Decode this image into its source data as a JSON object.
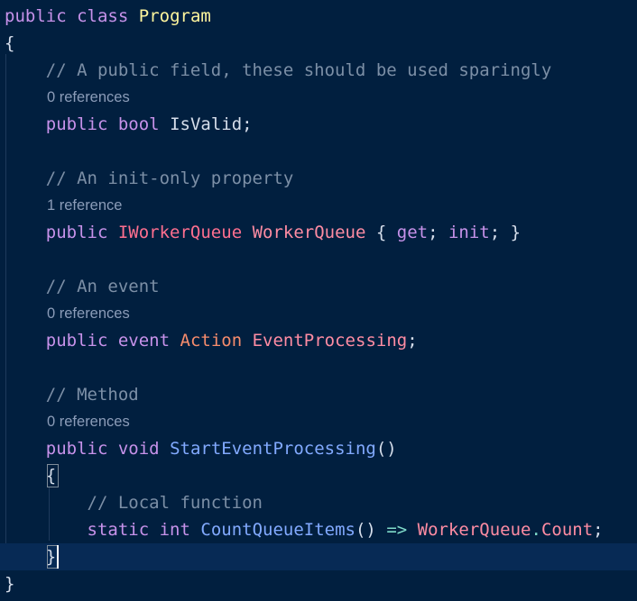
{
  "editor": {
    "language": "csharp",
    "lines": [
      {
        "tokens": [
          {
            "t": "public",
            "k": "kw"
          },
          {
            "t": " "
          },
          {
            "t": "class",
            "k": "kw"
          },
          {
            "t": " "
          },
          {
            "t": "Program",
            "k": "cls-name"
          }
        ]
      },
      {
        "tokens": [
          {
            "t": "{",
            "k": "punc"
          }
        ]
      },
      {
        "tokens": [
          {
            "t": "    "
          },
          {
            "t": "// A public field, these should be used sparingly",
            "k": "cmt2"
          }
        ]
      },
      {
        "lens": "0 references"
      },
      {
        "tokens": [
          {
            "t": "    "
          },
          {
            "t": "public",
            "k": "kw"
          },
          {
            "t": " "
          },
          {
            "t": "bool",
            "k": "kw"
          },
          {
            "t": " "
          },
          {
            "t": "IsValid",
            "k": "id"
          },
          {
            "t": ";",
            "k": "punc"
          }
        ]
      },
      {
        "tokens": []
      },
      {
        "tokens": [
          {
            "t": "    "
          },
          {
            "t": "// An init-only property",
            "k": "cmt2"
          }
        ]
      },
      {
        "lens": "1 reference"
      },
      {
        "tokens": [
          {
            "t": "    "
          },
          {
            "t": "public",
            "k": "kw"
          },
          {
            "t": " "
          },
          {
            "t": "IWorkerQueue",
            "k": "iface"
          },
          {
            "t": " "
          },
          {
            "t": "WorkerQueue",
            "k": "prop"
          },
          {
            "t": " { ",
            "k": "punc"
          },
          {
            "t": "get",
            "k": "kw"
          },
          {
            "t": "; ",
            "k": "punc"
          },
          {
            "t": "init",
            "k": "kw"
          },
          {
            "t": "; }",
            "k": "punc"
          }
        ]
      },
      {
        "tokens": []
      },
      {
        "tokens": [
          {
            "t": "    "
          },
          {
            "t": "// An event",
            "k": "cmt2"
          }
        ]
      },
      {
        "lens": "0 references"
      },
      {
        "tokens": [
          {
            "t": "    "
          },
          {
            "t": "public",
            "k": "kw"
          },
          {
            "t": " "
          },
          {
            "t": "event",
            "k": "kw"
          },
          {
            "t": " "
          },
          {
            "t": "Action",
            "k": "type"
          },
          {
            "t": " "
          },
          {
            "t": "EventProcessing",
            "k": "prop"
          },
          {
            "t": ";",
            "k": "punc"
          }
        ]
      },
      {
        "tokens": []
      },
      {
        "tokens": [
          {
            "t": "    "
          },
          {
            "t": "// Method",
            "k": "cmt2"
          }
        ]
      },
      {
        "lens": "0 references"
      },
      {
        "tokens": [
          {
            "t": "    "
          },
          {
            "t": "public",
            "k": "kw"
          },
          {
            "t": " "
          },
          {
            "t": "void",
            "k": "kw"
          },
          {
            "t": " "
          },
          {
            "t": "StartEventProcessing",
            "k": "fn"
          },
          {
            "t": "()",
            "k": "punc"
          }
        ]
      },
      {
        "tokens": [
          {
            "t": "    "
          },
          {
            "t": "{",
            "k": "punc"
          }
        ]
      },
      {
        "tokens": [
          {
            "t": "        "
          },
          {
            "t": "// Local function",
            "k": "cmt2"
          }
        ]
      },
      {
        "tokens": [
          {
            "t": "        "
          },
          {
            "t": "static",
            "k": "kw"
          },
          {
            "t": " "
          },
          {
            "t": "int",
            "k": "kw"
          },
          {
            "t": " "
          },
          {
            "t": "CountQueueItems",
            "k": "fn"
          },
          {
            "t": "() ",
            "k": "punc"
          },
          {
            "t": "=>",
            "k": "arrow"
          },
          {
            "t": " "
          },
          {
            "t": "WorkerQueue",
            "k": "prop"
          },
          {
            "t": ".",
            "k": "dot"
          },
          {
            "t": "Count",
            "k": "prop"
          },
          {
            "t": ";",
            "k": "punc"
          }
        ]
      },
      {
        "tokens": [
          {
            "t": "    "
          },
          {
            "t": "}",
            "k": "punc"
          }
        ],
        "current": true
      },
      {
        "tokens": [
          {
            "t": "}",
            "k": "punc"
          }
        ]
      }
    ]
  }
}
